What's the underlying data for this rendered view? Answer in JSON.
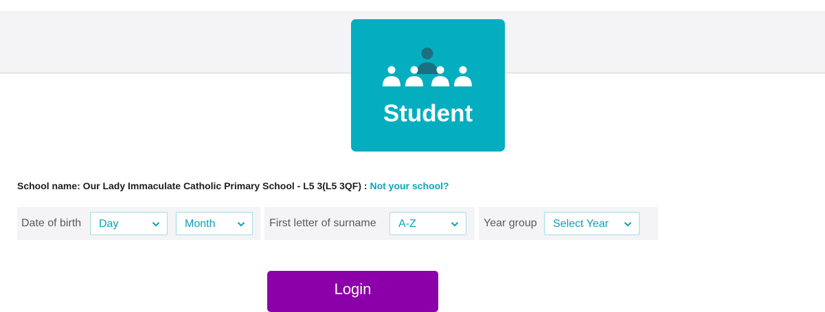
{
  "tile": {
    "label": "Student",
    "icon": "student-group-icon"
  },
  "school": {
    "prefix": "School name: Our Lady Immaculate Catholic Primary School - L5 3(L5 3QF) : ",
    "change_link": "Not your school?"
  },
  "dob": {
    "label": "Date of birth",
    "day": "Day",
    "month": "Month"
  },
  "surname": {
    "label": "First letter of surname",
    "value": "A-Z"
  },
  "year_group": {
    "label": "Year group",
    "value": "Select Year"
  },
  "login": {
    "label": "Login"
  },
  "colors": {
    "tile": "#04aebf",
    "accent": "#0aa4b6",
    "login_button": "#8b00a8"
  },
  "icons": {
    "select_chevron": "chevron-down-icon"
  }
}
